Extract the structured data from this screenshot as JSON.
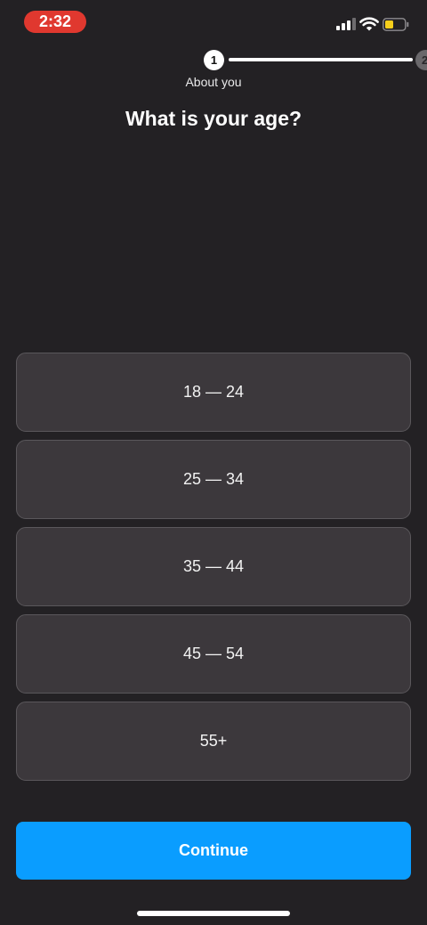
{
  "status_bar": {
    "time": "2:32",
    "icons": [
      "signal-icon",
      "wifi-icon",
      "battery-icon"
    ],
    "time_pill_color": "#e0382f",
    "battery_level_color": "#f6cf1b"
  },
  "stepper": {
    "current_step": "1",
    "next_step": "2",
    "current_label": "About you"
  },
  "question": {
    "title": "What is your age?"
  },
  "options": [
    {
      "label": "18 — 24"
    },
    {
      "label": "25 — 34"
    },
    {
      "label": "35 — 44"
    },
    {
      "label": "45 — 54"
    },
    {
      "label": "55+"
    }
  ],
  "actions": {
    "continue_label": "Continue",
    "continue_color": "#0a9dff"
  }
}
